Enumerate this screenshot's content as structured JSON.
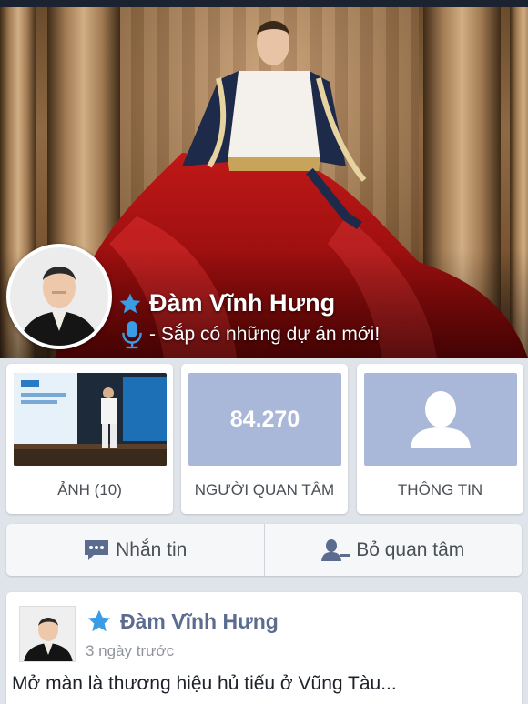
{
  "profile": {
    "name": "Đàm Vĩnh Hưng",
    "status": "- Sắp có những dự án mới!"
  },
  "cards": {
    "photos_label": "ẢNH (10)",
    "followers_count": "84.270",
    "followers_label": "NGƯỜI QUAN TÂM",
    "info_label": "THÔNG TIN"
  },
  "actions": {
    "message_label": "Nhắn tin",
    "unfollow_label": "Bỏ quan tâm"
  },
  "post": {
    "author": "Đàm Vĩnh Hưng",
    "time": "3 ngày trước",
    "text": "Mở màn là thương hiệu hủ tiếu ở Vũng Tàu..."
  },
  "icons": {
    "star": "star-icon",
    "mic": "microphone-icon",
    "message": "chat-bubble-icon",
    "unfollow": "person-minus-icon",
    "info": "person-silhouette-icon"
  },
  "colors": {
    "accent_blue": "#3b9ce6",
    "name_blue": "#5b6c8f",
    "tile_blue": "#a9b8d8"
  }
}
